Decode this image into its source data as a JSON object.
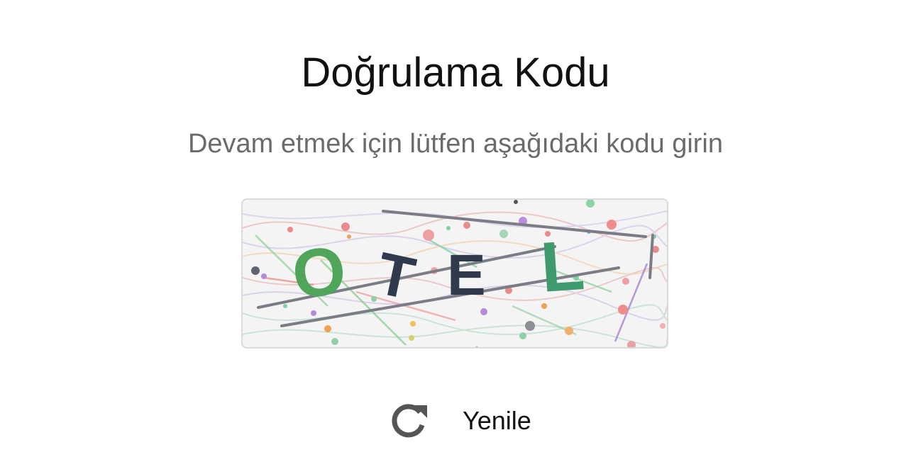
{
  "title": "Doğrulama Kodu",
  "subtitle": "Devam etmek için lütfen aşağıdaki kodu girin",
  "captcha": {
    "text": "OTEL",
    "letters": [
      {
        "char": "O",
        "color": "#4fa65a"
      },
      {
        "char": "T",
        "color": "#2f3a4c"
      },
      {
        "char": "E",
        "color": "#2f3a4c"
      },
      {
        "char": "L",
        "color": "#3f9a6e"
      }
    ],
    "image_alt": "Doğrulama kodu görseli"
  },
  "refresh": {
    "label": "Yenile",
    "icon": "refresh-icon",
    "icon_color": "#555555"
  }
}
